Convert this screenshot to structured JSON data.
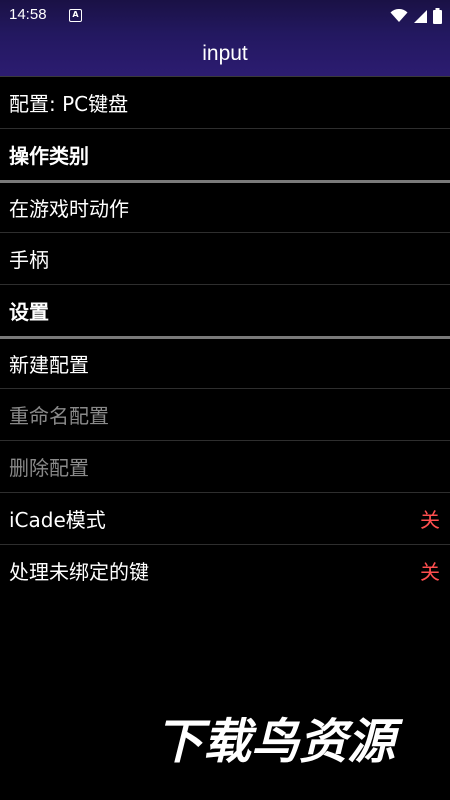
{
  "status_bar": {
    "time": "14:58",
    "notification_icon": "A",
    "icons": [
      "wifi-icon",
      "signal-icon",
      "battery-icon"
    ]
  },
  "header": {
    "title": "input"
  },
  "list": {
    "config": "配置: PC键盘",
    "category_header": "操作类别",
    "in_game_action": "在游戏时动作",
    "gamepad": "手柄",
    "settings_header": "设置",
    "new_config": "新建配置",
    "rename_config": "重命名配置",
    "delete_config": "删除配置",
    "icade_mode": {
      "label": "iCade模式",
      "value": "关"
    },
    "handle_unbound": {
      "label": "处理未绑定的键",
      "value": "关"
    }
  },
  "watermark": {
    "text": "下载鸟资源"
  },
  "colors": {
    "background": "#000000",
    "header_top": "#1a1145",
    "header_bottom": "#2c1c71",
    "value_red": "#ff4f4f",
    "disabled_text": "#8a8a8a"
  }
}
